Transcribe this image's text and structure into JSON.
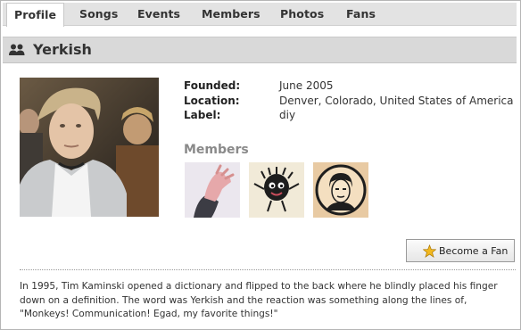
{
  "nav": {
    "tabs": [
      {
        "label": "Profile",
        "active": true
      },
      {
        "label": "Songs"
      },
      {
        "label": "Events"
      },
      {
        "label": "Members"
      },
      {
        "label": "Photos"
      },
      {
        "label": "Fans"
      }
    ]
  },
  "band": {
    "name": "Yerkish",
    "icon": "group-icon"
  },
  "info": {
    "founded_label": "Founded:",
    "founded_value": "June 2005",
    "location_label": "Location:",
    "location_value": "Denver, Colorado, United States of America",
    "label_label": "Label:",
    "label_value": "diy"
  },
  "members": {
    "heading": "Members",
    "avatars": [
      "member-avatar-hand",
      "member-avatar-creature",
      "member-avatar-portrait"
    ]
  },
  "fan_button": {
    "label": "Become a Fan",
    "icon": "star-icon"
  },
  "bio": {
    "text": "In 1995, Tim Kaminski opened a dictionary and flipped to the back where he blindly placed his finger down on a definition. The word was Yerkish and the reaction was something along the lines of, \"Monkeys! Communication! Egad, my favorite things!\""
  },
  "colors": {
    "tab_bar": "#e3e3e3",
    "header_bar": "#d9d9d9",
    "members_heading": "#8a8a8a",
    "star": "#f2b81e"
  }
}
